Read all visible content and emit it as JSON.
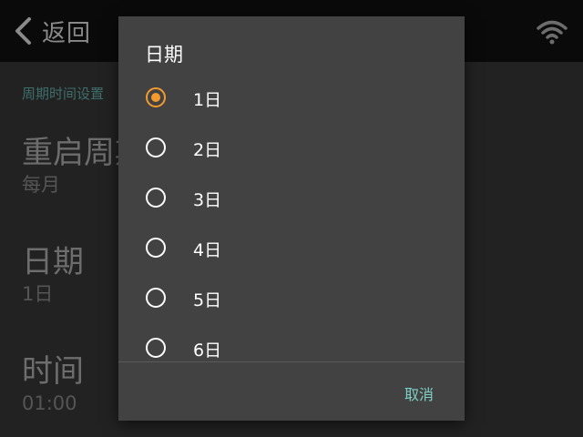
{
  "topbar": {
    "back_label": "返回",
    "back_icon": "chevron-left",
    "wifi_icon": "wifi"
  },
  "settings": {
    "section_header": "周期时间设置",
    "items": [
      {
        "title": "重启周期",
        "value": "每月"
      },
      {
        "title": "日期",
        "value": "1日"
      },
      {
        "title": "时间",
        "value": "01:00"
      }
    ]
  },
  "dialog": {
    "title": "日期",
    "selected_index": 0,
    "options": [
      "1日",
      "2日",
      "3日",
      "4日",
      "5日",
      "6日"
    ],
    "cancel_label": "取消"
  },
  "colors": {
    "accent_radio": "#f29a2e",
    "cancel_text": "#7fd0c4",
    "section_header": "#3f6e6b"
  }
}
